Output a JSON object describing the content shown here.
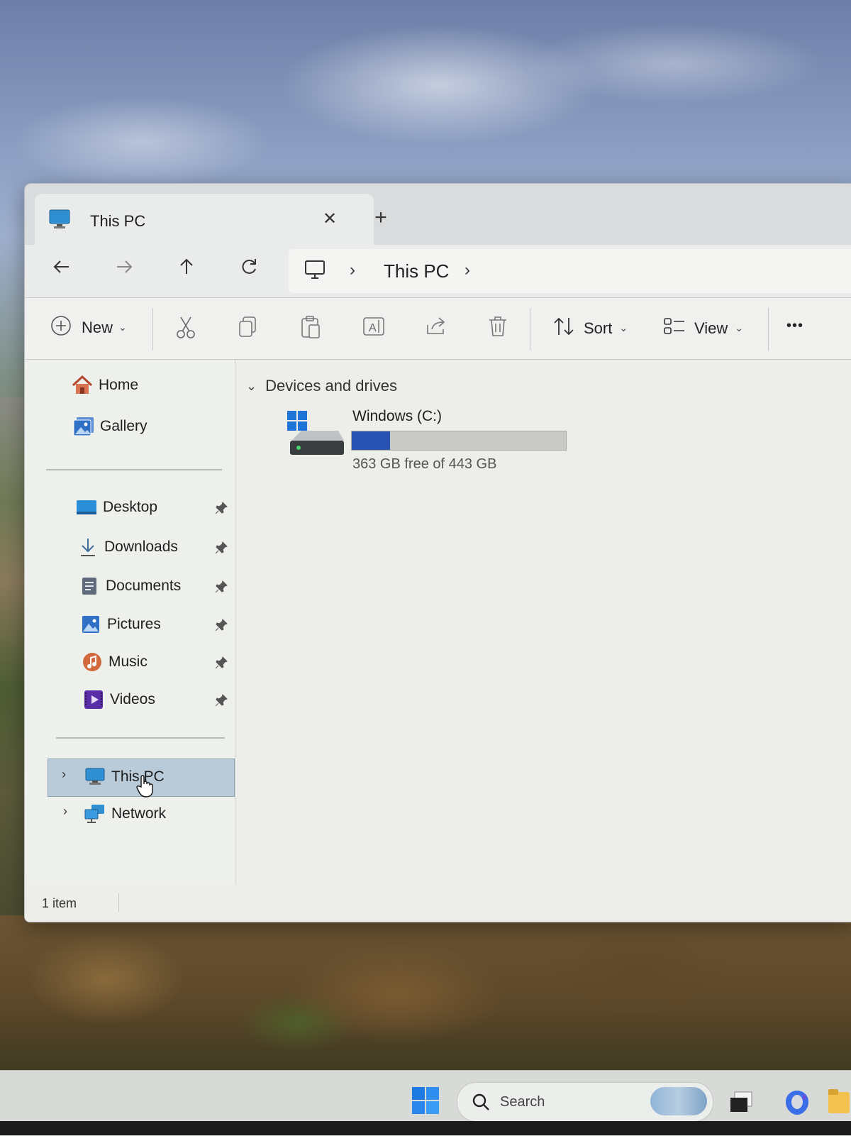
{
  "window": {
    "tab_title": "This PC",
    "new_tab_symbol": "+",
    "close_symbol": "✕"
  },
  "nav": {
    "back_icon": "arrow-left-icon",
    "forward_icon": "arrow-right-icon",
    "up_icon": "arrow-up-icon",
    "refresh_icon": "refresh-icon",
    "address": {
      "location_icon": "monitor-icon",
      "path": [
        "This PC"
      ]
    }
  },
  "toolbar": {
    "new_label": "New",
    "sort_label": "Sort",
    "view_label": "View",
    "more_label": "•••",
    "icons": [
      "plus-icon",
      "cut-icon",
      "copy-icon",
      "paste-icon",
      "rename-icon",
      "share-icon",
      "delete-icon"
    ]
  },
  "sidebar": {
    "top_items": [
      {
        "label": "Home",
        "icon": "home-icon"
      },
      {
        "label": "Gallery",
        "icon": "gallery-icon"
      }
    ],
    "pinned": [
      {
        "label": "Desktop",
        "icon": "desktop-icon"
      },
      {
        "label": "Downloads",
        "icon": "download-icon"
      },
      {
        "label": "Documents",
        "icon": "documents-icon"
      },
      {
        "label": "Pictures",
        "icon": "pictures-icon"
      },
      {
        "label": "Music",
        "icon": "music-icon"
      },
      {
        "label": "Videos",
        "icon": "videos-icon"
      }
    ],
    "tree": [
      {
        "label": "This PC",
        "icon": "monitor-icon",
        "selected": true
      },
      {
        "label": "Network",
        "icon": "network-icon",
        "selected": false
      }
    ]
  },
  "content": {
    "group_title": "Devices and drives",
    "drives": [
      {
        "name": "Windows (C:)",
        "free_text": "363 GB free of 443 GB",
        "used_fraction": 0.18
      }
    ]
  },
  "status": {
    "item_count": "1 item"
  },
  "taskbar": {
    "search_label": "Search"
  },
  "colors": {
    "accent": "#2954b3",
    "selection": "#b9cbd9",
    "window_bg": "#edeee9"
  }
}
